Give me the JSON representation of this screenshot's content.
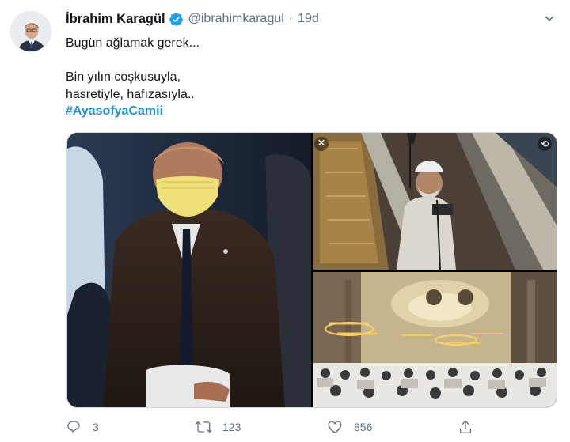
{
  "tweet": {
    "author_name": "İbrahim Karagül",
    "handle": "@ibrahimkaragul",
    "separator": "·",
    "time": "19d",
    "lines": [
      "Bugün ağlamak gerek...",
      "Bin yılın coşkusuyla,",
      "hasretiyle, hafızasıyla.."
    ],
    "hashtag": "#AyasofyaCamii"
  },
  "media": {
    "close_glyph": "✕",
    "rotate_glyph": "⟲"
  },
  "actions": {
    "reply_count": "3",
    "retweet_count": "123",
    "like_count": "856"
  },
  "icons": {
    "verified": "verified-badge-icon",
    "caret": "chevron-down-icon",
    "reply": "reply-icon",
    "retweet": "retweet-icon",
    "like": "heart-icon",
    "share": "share-icon"
  },
  "colors": {
    "accent": "#1b95e0",
    "secondary_text": "#5b7083",
    "verified": "#1da1f2"
  }
}
